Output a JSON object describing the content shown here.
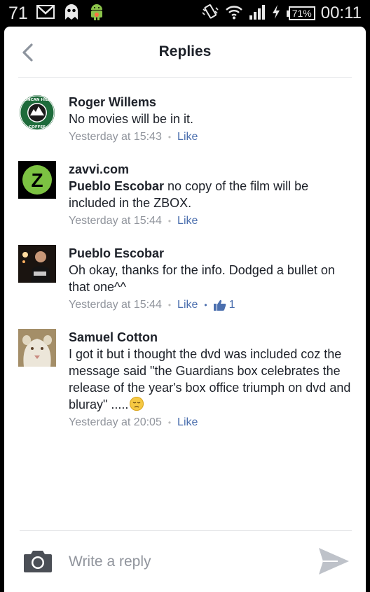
{
  "status_bar": {
    "notification_count": "71",
    "battery_percent": "71%",
    "time": "00:11"
  },
  "header": {
    "title": "Replies"
  },
  "comments": [
    {
      "author": "Roger Willems",
      "text": "No movies will be in it.",
      "time": "Yesterday at 15:43",
      "like_label": "Like",
      "avatar": {
        "type": "logo",
        "text_top": "DUNCAN HILLS",
        "text_bottom": "COFFEE"
      }
    },
    {
      "author": "zavvi.com",
      "mention": "Pueblo Escobar",
      "text": " no copy of the film will be included in the ZBOX.",
      "time": "Yesterday at 15:44",
      "like_label": "Like",
      "avatar": {
        "type": "logo",
        "letter": "Z"
      }
    },
    {
      "author": "Pueblo Escobar",
      "text": "Oh okay, thanks for the info. Dodged a bullet on that one^^",
      "time": "Yesterday at 15:44",
      "like_label": "Like",
      "like_count": "1",
      "avatar": {
        "type": "photo"
      }
    },
    {
      "author": "Samuel Cotton",
      "text": "I got it but i thought the dvd was included coz the message said  \"the Guardians box celebrates the release of the year's box office triumph on dvd and bluray\" .....",
      "time": "Yesterday at 20:05",
      "like_label": "Like",
      "avatar": {
        "type": "photo"
      }
    }
  ],
  "composer": {
    "placeholder": "Write a reply"
  },
  "colors": {
    "link": "#4b6fae",
    "meta": "#90949c",
    "text": "#1d2129",
    "zavvi_green": "#7cc242"
  },
  "icons": [
    "gmail-icon",
    "ghost-app-icon",
    "android-icon",
    "vibrate-icon",
    "wifi-icon",
    "signal-icon",
    "charging-icon",
    "battery-icon",
    "back-chevron-icon",
    "thumbs-up-icon",
    "disappointed-emoji-icon",
    "camera-icon",
    "send-icon"
  ]
}
